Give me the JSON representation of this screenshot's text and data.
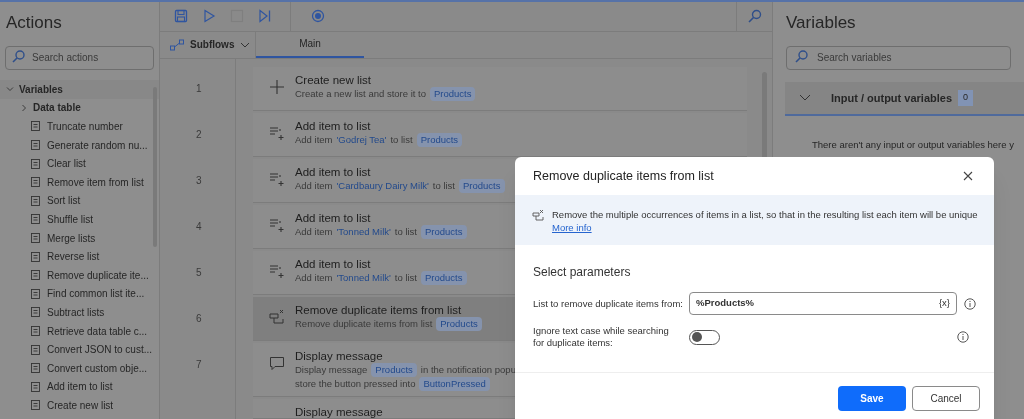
{
  "actions_panel": {
    "title": "Actions",
    "search": {
      "placeholder": "Search actions"
    },
    "tree": [
      {
        "label": "Variables",
        "expanded": true,
        "children": [
          {
            "label": "Data table",
            "expanded": false
          },
          {
            "label": "Truncate number"
          },
          {
            "label": "Generate random nu..."
          },
          {
            "label": "Clear list"
          },
          {
            "label": "Remove item from list"
          },
          {
            "label": "Sort list"
          },
          {
            "label": "Shuffle list"
          },
          {
            "label": "Merge lists"
          },
          {
            "label": "Reverse list"
          },
          {
            "label": "Remove duplicate ite..."
          },
          {
            "label": "Find common list ite..."
          },
          {
            "label": "Subtract lists"
          },
          {
            "label": "Retrieve data table c..."
          },
          {
            "label": "Convert JSON to cust..."
          },
          {
            "label": "Convert custom obje..."
          },
          {
            "label": "Add item to list"
          },
          {
            "label": "Create new list"
          }
        ]
      }
    ]
  },
  "toolbar": [
    {
      "kind": "save",
      "disabled": false
    },
    {
      "kind": "run",
      "disabled": false
    },
    {
      "kind": "stop",
      "disabled": true
    },
    {
      "kind": "step",
      "disabled": false
    },
    {
      "kind": "record",
      "disabled": false
    }
  ],
  "subflows": {
    "label": "Subflows"
  },
  "tabs": [
    {
      "label": "Main",
      "selected": true
    }
  ],
  "flow": [
    {
      "number": "1",
      "kind": "create",
      "title": "Create new list",
      "selected": false,
      "description": [
        {
          "kind": "text",
          "text": "Create a new list and store it to"
        },
        {
          "kind": "variable",
          "text": "Products"
        }
      ]
    },
    {
      "number": "2",
      "kind": "add",
      "title": "Add item to list",
      "selected": false,
      "description": [
        {
          "kind": "text",
          "text": "Add item"
        },
        {
          "kind": "literal",
          "text": "'Godrej Tea'"
        },
        {
          "kind": "text",
          "text": "to list"
        },
        {
          "kind": "variable",
          "text": "Products"
        }
      ]
    },
    {
      "number": "3",
      "kind": "add",
      "title": "Add item to list",
      "selected": false,
      "description": [
        {
          "kind": "text",
          "text": "Add item"
        },
        {
          "kind": "literal",
          "text": "'Cardbaury Dairy Milk'"
        },
        {
          "kind": "text",
          "text": "to list"
        },
        {
          "kind": "variable",
          "text": "Products"
        }
      ]
    },
    {
      "number": "4",
      "kind": "add",
      "title": "Add item to list",
      "selected": false,
      "description": [
        {
          "kind": "text",
          "text": "Add item"
        },
        {
          "kind": "literal",
          "text": "'Tonned Milk'"
        },
        {
          "kind": "text",
          "text": "to list"
        },
        {
          "kind": "variable",
          "text": "Products"
        }
      ]
    },
    {
      "number": "5",
      "kind": "add",
      "title": "Add item to list",
      "selected": false,
      "description": [
        {
          "kind": "text",
          "text": "Add item"
        },
        {
          "kind": "literal",
          "text": "'Tonned Milk'"
        },
        {
          "kind": "text",
          "text": "to list"
        },
        {
          "kind": "variable",
          "text": "Products"
        }
      ]
    },
    {
      "number": "6",
      "kind": "dedupe",
      "title": "Remove duplicate items from list",
      "selected": true,
      "description": [
        {
          "kind": "text",
          "text": "Remove duplicate items from list"
        },
        {
          "kind": "variable",
          "text": "Products"
        }
      ]
    },
    {
      "number": "7",
      "kind": "message",
      "title": "Display message",
      "selected": false,
      "description": [
        {
          "kind": "text",
          "text": "Display message"
        },
        {
          "kind": "variable",
          "text": "Products"
        },
        {
          "kind": "text",
          "text": "in the notification popu"
        },
        {
          "kind": "break"
        },
        {
          "kind": "text",
          "text": "store the button pressed into"
        },
        {
          "kind": "variable",
          "text": "ButtonPressed"
        }
      ]
    },
    {
      "kind": "message",
      "title": "Display message",
      "selected": false
    }
  ],
  "variables_panel": {
    "title": "Variables",
    "search": {
      "placeholder": "Search variables"
    },
    "section": {
      "title": "Input / output variables",
      "count": "0",
      "expanded": true,
      "empty_text": "There aren't any input or output variables here y"
    }
  },
  "dialog": {
    "title": "Remove duplicate items from list",
    "info": "Remove the multiple occurrences of items in a list, so that in the resulting list each item will be unique",
    "info_link": "More info",
    "section_title": "Select parameters",
    "fields": [
      {
        "kind": "text",
        "label": "List to remove duplicate items from:",
        "value": "%Products%",
        "suffix": "{x}"
      },
      {
        "kind": "toggle",
        "label": "Ignore text case while searching for duplicate items:",
        "on": false
      }
    ],
    "buttons": [
      {
        "label": "Save",
        "primary": true
      },
      {
        "label": "Cancel",
        "primary": false
      }
    ]
  }
}
